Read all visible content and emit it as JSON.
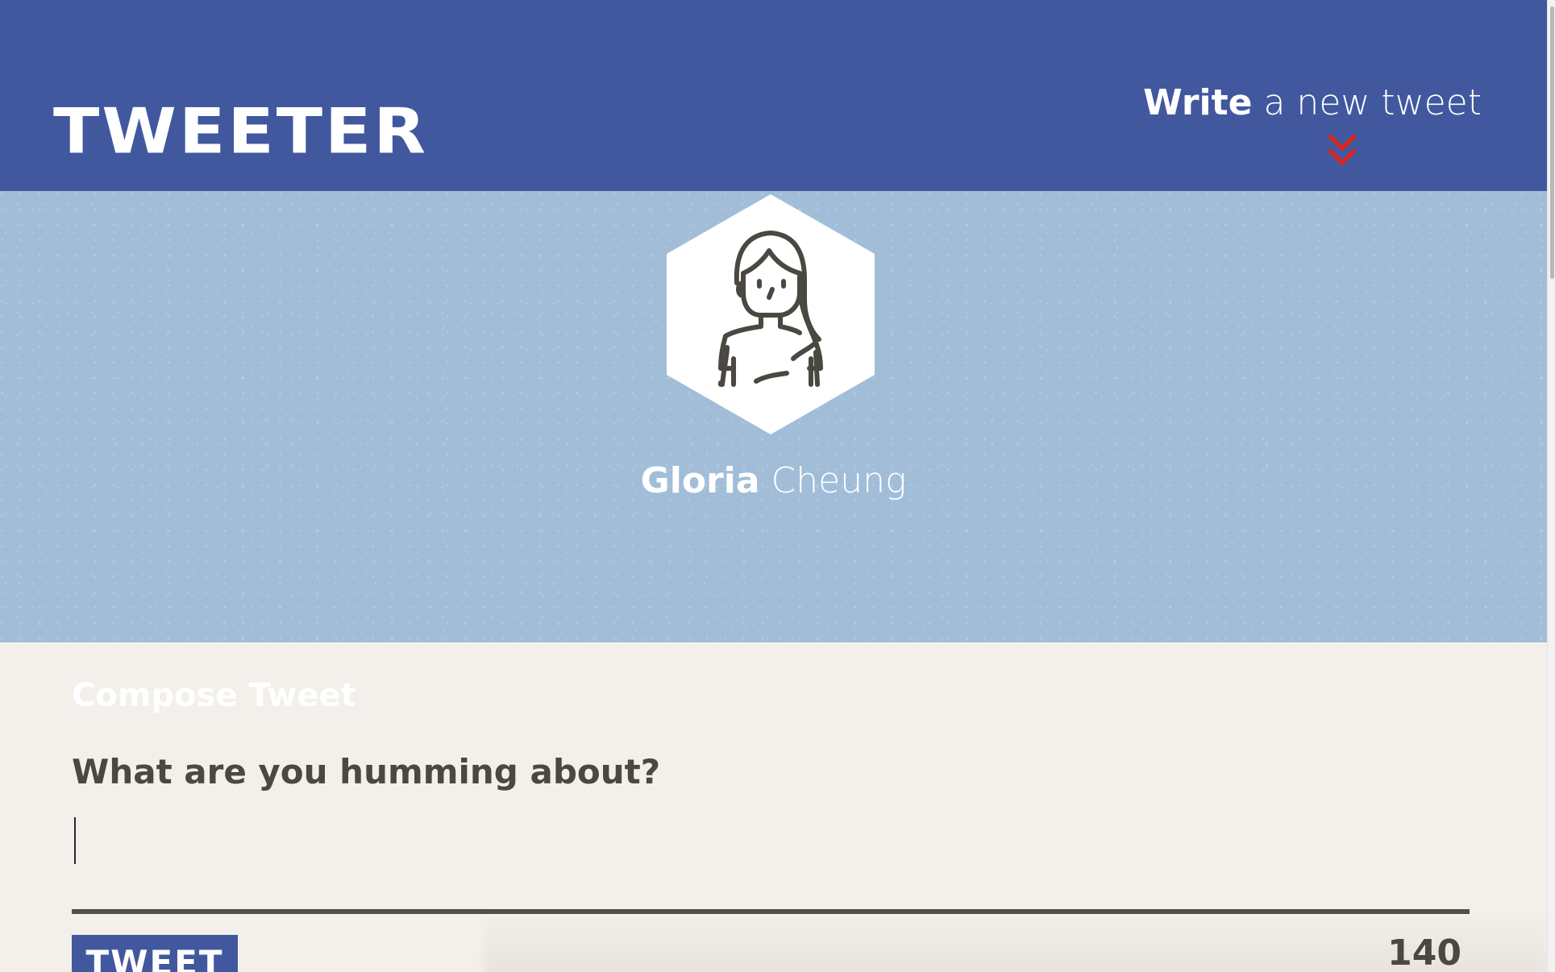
{
  "header": {
    "brand": "TWEETER",
    "write_bold": "Write",
    "write_rest": " a new tweet",
    "toggle_icon": "double-chevron-down-icon",
    "nav_color": "#41589f",
    "chevron_color": "#e2231a"
  },
  "profile": {
    "avatar_icon": "woman-avatar-icon",
    "first_name": "Gloria",
    "last_name": " Cheung",
    "banner_color": "#a1bdd8"
  },
  "compose": {
    "title": "Compose Tweet",
    "prompt": "What are you humming about?",
    "text_value": "",
    "button_label": "TWEET",
    "counter": "140"
  }
}
